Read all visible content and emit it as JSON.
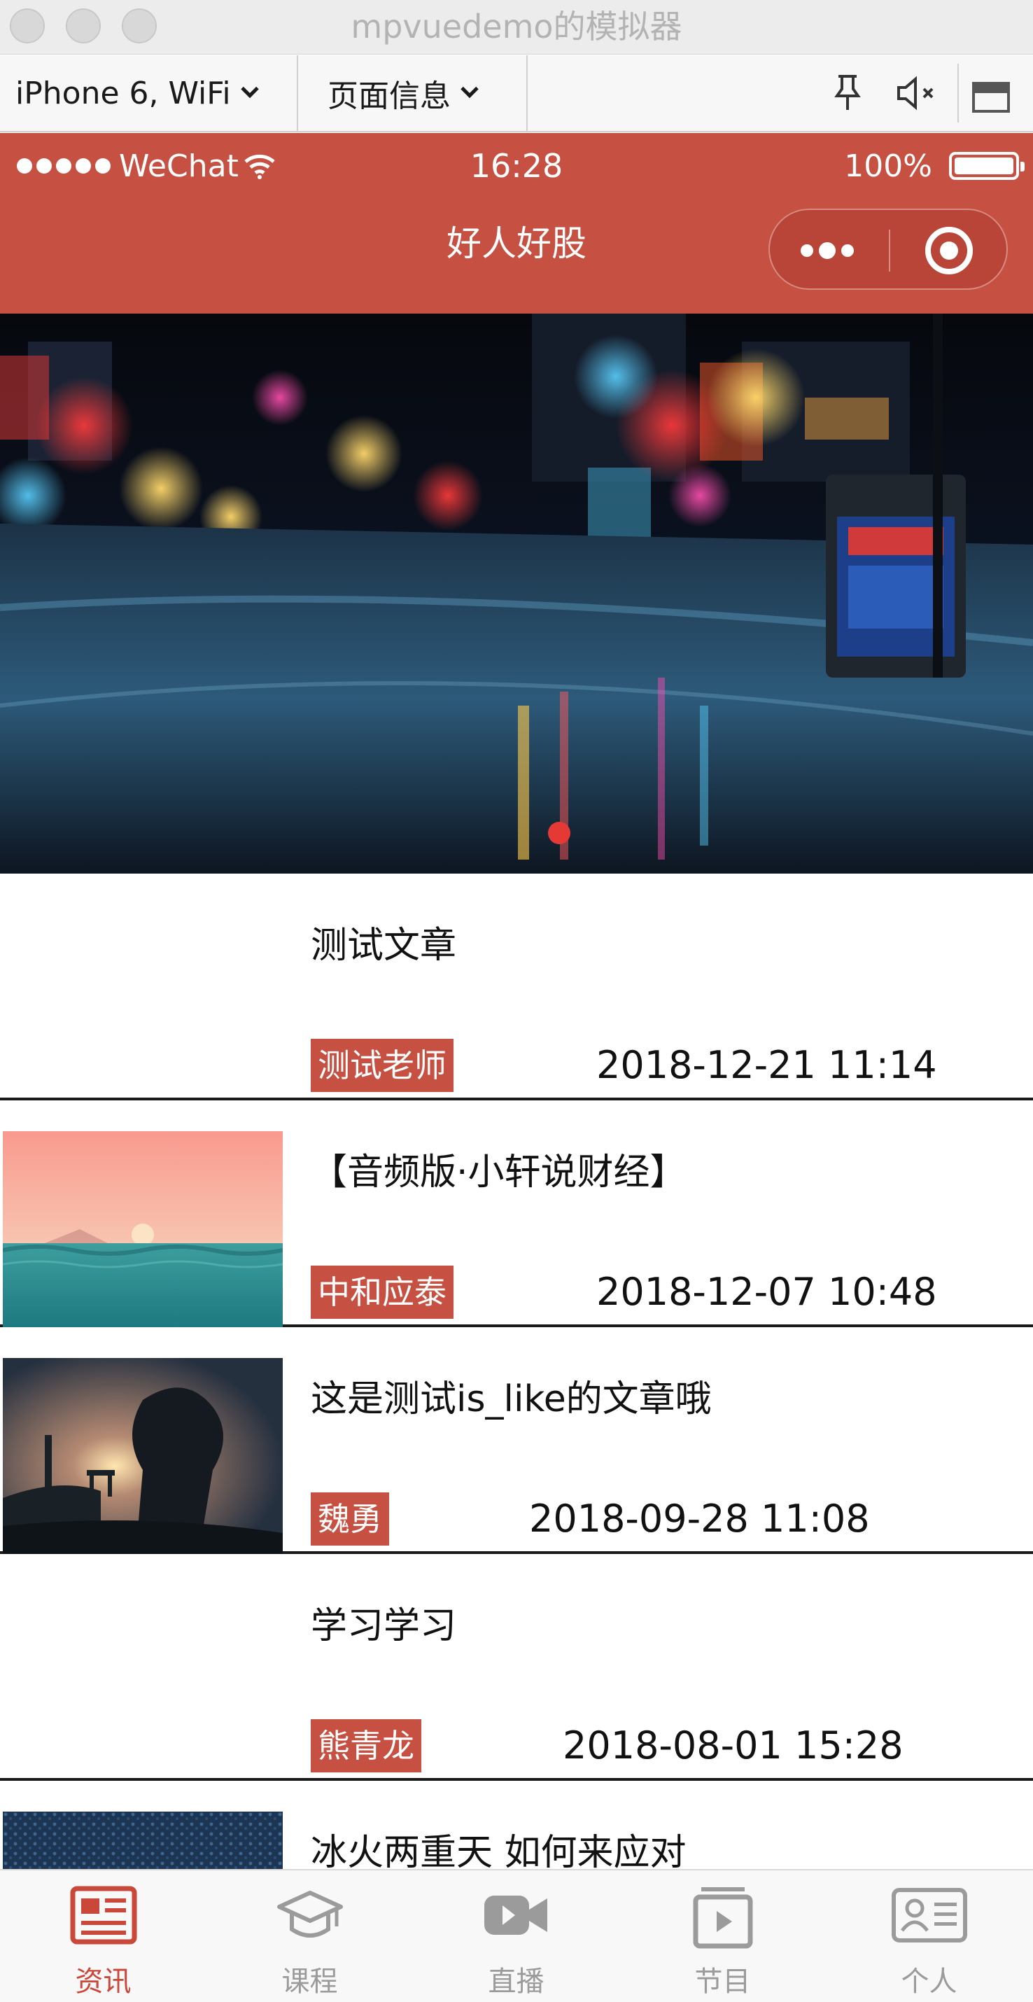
{
  "window": {
    "title": "mpvuedemo的模拟器"
  },
  "toolbar": {
    "device_label": "iPhone 6, WiFi",
    "page_info_label": "页面信息"
  },
  "status_bar": {
    "carrier": "WeChat",
    "time": "16:28",
    "battery": "100%",
    "battery_level": 1.0
  },
  "nav_bar": {
    "title": "好人好股"
  },
  "banner": {
    "slide_count": 1,
    "active_index": 0
  },
  "articles": [
    {
      "title": "测试文章",
      "author": "测试老师",
      "date": "2018-12-21 11:14",
      "thumbnail": "none"
    },
    {
      "title": "【音频版·小轩说财经】",
      "author": "中和应泰",
      "date": "2018-12-07 10:48",
      "thumbnail": "pink-sunset-sea"
    },
    {
      "title": "这是测试is_like的文章哦",
      "author": "魏勇",
      "date": "2018-09-28 11:08",
      "thumbnail": "night-fantasy-landscape"
    },
    {
      "title": "学习学习",
      "author": "熊青龙",
      "date": "2018-08-01 15:28",
      "thumbnail": "none"
    },
    {
      "title": "冰火两重天 如何来应对",
      "author": "",
      "date": "",
      "thumbnail": "blue-texture"
    }
  ],
  "tabbar": {
    "items": [
      {
        "label": "资讯",
        "icon": "news-icon",
        "active": true
      },
      {
        "label": "课程",
        "icon": "graduation-cap-icon",
        "active": false
      },
      {
        "label": "直播",
        "icon": "video-camera-icon",
        "active": false
      },
      {
        "label": "节目",
        "icon": "play-box-icon",
        "active": false
      },
      {
        "label": "个人",
        "icon": "id-card-icon",
        "active": false
      }
    ]
  },
  "colors": {
    "brand": "#c65142",
    "tab_active": "#c9483a",
    "tab_inactive": "#9b9b9b",
    "indicator": "#e53935"
  }
}
